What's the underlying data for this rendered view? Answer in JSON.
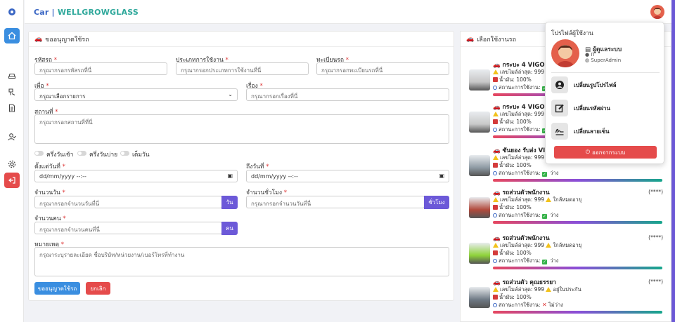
{
  "brand": {
    "part1": "Car |",
    "part2": "WELLGROWGLASS"
  },
  "form": {
    "title": "ขออนุญาตใช้รถ",
    "vehicle_code": {
      "label": "รหัสรถ",
      "placeholder": "กรุณากรอกรหัสรถที่นี่"
    },
    "usage_type": {
      "label": "ประเภทการใช้งาน",
      "placeholder": "กรุณากรอกประเภทการใช้งานที่นี่"
    },
    "plate": {
      "label": "ทะเบียนรถ",
      "placeholder": "กรุณากรอกทะเบียนรถที่นี่"
    },
    "purpose": {
      "label": "เพื่อ",
      "value": "กรุณาเลือกรายการ"
    },
    "subject": {
      "label": "เรื่อง",
      "placeholder": "กรุณากรอกเรื่องที่นี่"
    },
    "location": {
      "label": "สถานที่",
      "placeholder": "กรุณากรอกสถานที่ที่นี่"
    },
    "toggles": {
      "morning": "ครึ่งวันเช้า",
      "afternoon": "ครึ่งวันบ่าย",
      "full": "เต็มวัน"
    },
    "start_date": {
      "label": "ตั้งแต่วันที่",
      "value": "dd/mm/yyyy --:--"
    },
    "end_date": {
      "label": "ถึงวันที่",
      "value": "dd/mm/yyyy --:--"
    },
    "days": {
      "label": "จำนวนวัน",
      "placeholder": "กรุณากรอกจำนวนวันที่นี่",
      "unit": "วัน"
    },
    "hours": {
      "label": "จำนวนชั่วโมง",
      "placeholder": "กรุณากรอกจำนวนวันที่นี่",
      "unit": "ชั่วโมง"
    },
    "people": {
      "label": "จำนวนคน",
      "placeholder": "กรุณากรอกจำนวนคนที่นี่",
      "unit": "คน"
    },
    "note": {
      "label": "หมายเหตุ",
      "placeholder": "กรุณาระบุรายละเอียด ชื่อบริษัท/หน่วยงาน/เบอร์โทรที่ทำงาน"
    },
    "submit_label": "ขออนุญาตใช้รถ",
    "cancel_label": "ยกเลิก",
    "required_mark": "*"
  },
  "vehicles": {
    "title": "เลือกใช้งานรถ",
    "items": [
      {
        "name": "กระบะ 4 VIGO",
        "mileage": "เลขไมล์ล่าสุด: 999",
        "insurance": "",
        "fuel": "น้ำมัน: 100%",
        "status_label": "สถานะการใช้งาน:",
        "status": "",
        "stars": "",
        "available": true,
        "img": "#c7c7c7"
      },
      {
        "name": "กระบะ 4 VIGO",
        "mileage": "เลขไมล์ล่าสุด: 999",
        "insurance": "",
        "fuel": "น้ำมัน: 100%",
        "status_label": "สถานะการใช้งาน:",
        "status": "",
        "stars": "",
        "available": true,
        "img": "#c9c9c9"
      },
      {
        "name": "ซันยอง รับส่ง VIP",
        "mileage": "เลขไมล์ล่าสุด: 999",
        "insurance": "",
        "fuel": "น้ำมัน: 100%",
        "status_label": "สถานะการใช้งาน:",
        "status": "ว่าง",
        "stars": "",
        "available": true,
        "img": "#8e9aa3"
      },
      {
        "name": "รถส่วนตัวพนักงาน",
        "mileage": "เลขไมล์ล่าสุด: 999",
        "insurance": "ใกล้หมดอายุ",
        "fuel": "น้ำมัน: 100%",
        "status_label": "สถานะการใช้งาน:",
        "status": "ว่าง",
        "stars": "(****)",
        "available": true,
        "img": "#b14a3c"
      },
      {
        "name": "รถส่วนตัวพนักงาน",
        "mileage": "เลขไมล์ล่าสุด: 999",
        "insurance": "ใกล้หมดอายุ",
        "fuel": "น้ำมัน: 100%",
        "status_label": "สถานะการใช้งาน:",
        "status": "ว่าง",
        "stars": "(****)",
        "available": true,
        "img": "#8fd33a"
      },
      {
        "name": "รถส่วนตัว คุณธรรยา",
        "mileage": "เลขไมล์ล่าสุด: 999",
        "insurance": "อยู่ในประกัน",
        "fuel": "น้ำมัน: 100%",
        "status_label": "สถานะการใช้งาน:",
        "status": "ไม่ว่าง",
        "stars": "(****)",
        "available": false,
        "img": "#6f7a85"
      }
    ]
  },
  "profile": {
    "title": "โปรไฟล์ผู้ใช้งาน",
    "role": "ผู้ดูแลระบบ",
    "dept": "IT",
    "level": "SuperAdmin",
    "change_photo": "เปลี่ยนรูปโปรไฟล์",
    "change_password": "เปลี่ยนรหัสผ่าน",
    "change_signature": "เปลี่ยนลายเซ็น",
    "logout": "ออกจากระบบ"
  },
  "colors": {
    "primary": "#3a66c4",
    "accent": "#6c59d8",
    "danger": "#e54b4b",
    "teal": "#2fa89b"
  }
}
